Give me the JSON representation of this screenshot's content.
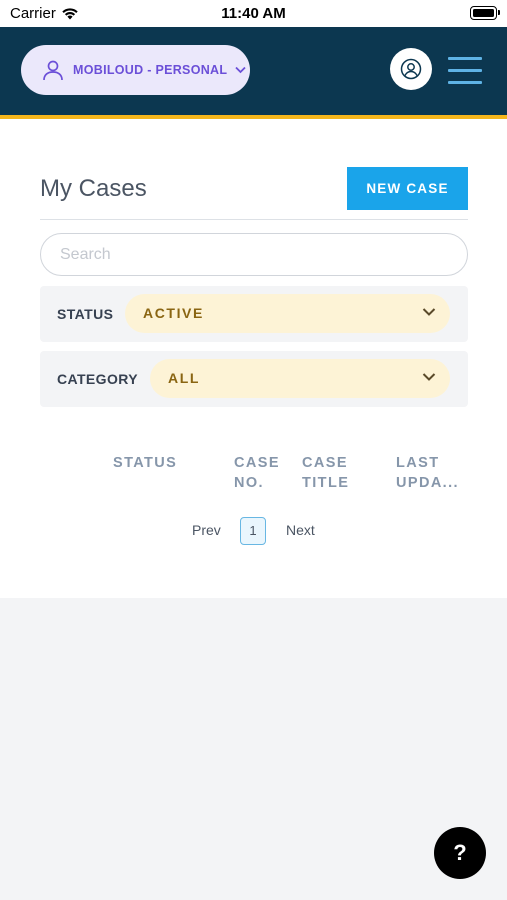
{
  "status_bar": {
    "carrier": "Carrier",
    "time": "11:40 AM",
    "wifi_icon": "wifi-icon",
    "battery_icon": "battery-full-icon"
  },
  "header": {
    "account_label": "MOBILOUD - PERSONAL",
    "account_icon": "user-outline-icon",
    "profile_icon": "user-circle-icon",
    "menu_icon": "hamburger-menu-icon",
    "colors": {
      "background": "#0c3750",
      "accent": "#f5b61c",
      "pill": "#ebe8fb",
      "pill_text": "#6b4fd8"
    }
  },
  "main": {
    "title": "My Cases",
    "new_case_label": "NEW CASE",
    "search_placeholder": "Search",
    "filters": [
      {
        "label": "STATUS",
        "value": "ACTIVE"
      },
      {
        "label": "CATEGORY",
        "value": "ALL"
      }
    ],
    "table": {
      "columns": [
        {
          "line1": "STATUS",
          "line2": ""
        },
        {
          "line1": "CASE",
          "line2": "NO."
        },
        {
          "line1": "CASE",
          "line2": "TITLE"
        },
        {
          "line1": "LAST",
          "line2": "UPDA..."
        }
      ],
      "rows": []
    },
    "pagination": {
      "prev": "Prev",
      "current": "1",
      "next": "Next"
    },
    "colors": {
      "button": "#1aa4ea",
      "select_bg": "#fdf3d6",
      "select_text": "#8a6512"
    }
  },
  "help": {
    "label": "?",
    "icon": "help-icon"
  }
}
